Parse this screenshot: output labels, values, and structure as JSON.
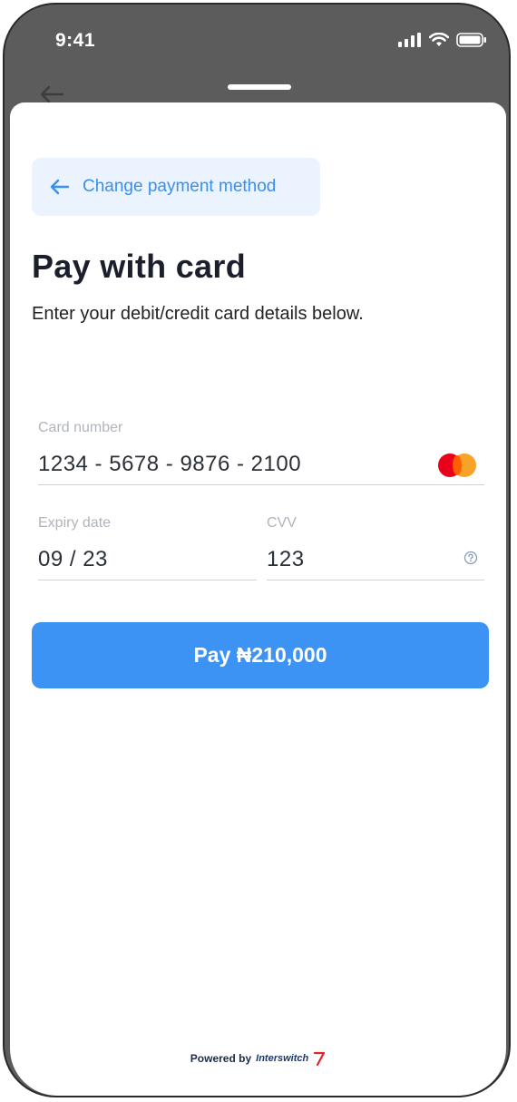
{
  "status_bar": {
    "time": "9:41"
  },
  "header": {
    "back_button_label": "Change payment method"
  },
  "page": {
    "title": "Pay with card",
    "subtitle": "Enter your debit/credit card details below."
  },
  "form": {
    "card_number": {
      "label": "Card number",
      "value": "1234 - 5678 - 9876 - 2100",
      "brand_icon": "mastercard-icon"
    },
    "expiry": {
      "label": "Expiry date",
      "value": "09 / 23"
    },
    "cvv": {
      "label": "CVV",
      "value": "123",
      "help_icon": "help-circle-icon"
    }
  },
  "actions": {
    "pay_label": "Pay ₦210,000"
  },
  "footer": {
    "powered_by": "Powered by",
    "brand": "Interswitch"
  },
  "colors": {
    "accent": "#3d93f4",
    "back_button_bg": "#eaf3fe",
    "back_button_text": "#3b8fec",
    "phone_frame": "#5c5c5c"
  }
}
